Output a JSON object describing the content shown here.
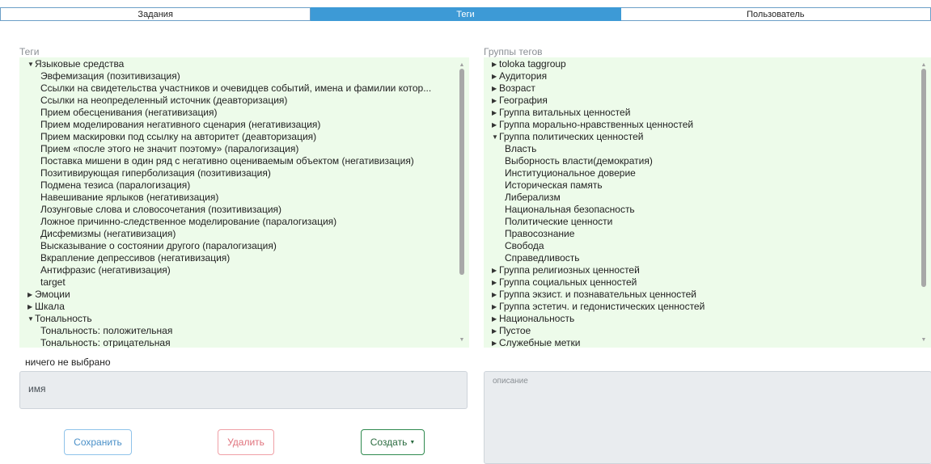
{
  "tabs": [
    {
      "label": "Задания",
      "active": false
    },
    {
      "label": "Теги",
      "active": true
    },
    {
      "label": "Пользователь",
      "active": false
    }
  ],
  "tags_panel": {
    "label": "Теги",
    "items": [
      {
        "text": "Языковые средства",
        "level": 0,
        "state": "expanded"
      },
      {
        "text": "Эвфемизация (позитивизация)",
        "level": 1
      },
      {
        "text": "Ссылки на свидетельства участников и очевидцев событий, имена и фамилии котор...",
        "level": 1
      },
      {
        "text": "Ссылки на неопределенный источник (деавторизация)",
        "level": 1
      },
      {
        "text": "Прием обесценивания (негативизация)",
        "level": 1
      },
      {
        "text": "Прием моделирования негативного сценария (негативизация)",
        "level": 1
      },
      {
        "text": "Прием маскировки под ссылку на авторитет (деавторизация)",
        "level": 1
      },
      {
        "text": "Прием «после этого не значит поэтому» (паралогизация)",
        "level": 1
      },
      {
        "text": "Поставка мишени в один ряд с негативно оцениваемым объектом (негативизация)",
        "level": 1
      },
      {
        "text": "Позитивирующая гиперболизация (позитивизация)",
        "level": 1
      },
      {
        "text": "Подмена тезиса (паралогизация)",
        "level": 1
      },
      {
        "text": "Навешивание ярлыков (негативизация)",
        "level": 1
      },
      {
        "text": "Лозунговые слова и словосочетания (позитивизация)",
        "level": 1
      },
      {
        "text": "Ложное причинно-следственное моделирование (паралогизация)",
        "level": 1
      },
      {
        "text": "Дисфемизмы (негативизация)",
        "level": 1
      },
      {
        "text": "Высказывание о состоянии другого (паралогизация)",
        "level": 1
      },
      {
        "text": "Вкрапление депрессивов (негативизация)",
        "level": 1
      },
      {
        "text": "Антифразис (негативизация)",
        "level": 1
      },
      {
        "text": "target",
        "level": 1
      },
      {
        "text": "Эмоции",
        "level": 0,
        "state": "collapsed"
      },
      {
        "text": "Шкала",
        "level": 0,
        "state": "collapsed"
      },
      {
        "text": "Тональность",
        "level": 0,
        "state": "expanded"
      },
      {
        "text": "Тональность: положительная",
        "level": 1
      },
      {
        "text": "Тональность: отрицательная",
        "level": 1
      }
    ]
  },
  "groups_panel": {
    "label": "Группы тегов",
    "items": [
      {
        "text": "toloka taggroup",
        "level": 0,
        "state": "collapsed"
      },
      {
        "text": "Аудитория",
        "level": 0,
        "state": "collapsed"
      },
      {
        "text": "Возраст",
        "level": 0,
        "state": "collapsed"
      },
      {
        "text": "География",
        "level": 0,
        "state": "collapsed"
      },
      {
        "text": "Группа витальных ценностей",
        "level": 0,
        "state": "collapsed"
      },
      {
        "text": "Группа морально-нравственных ценностей",
        "level": 0,
        "state": "collapsed"
      },
      {
        "text": "Группа политических ценностей",
        "level": 0,
        "state": "expanded"
      },
      {
        "text": "Власть",
        "level": 1
      },
      {
        "text": "Выборность власти(демократия)",
        "level": 1
      },
      {
        "text": "Институциональное доверие",
        "level": 1
      },
      {
        "text": "Историческая память",
        "level": 1
      },
      {
        "text": "Либерализм",
        "level": 1
      },
      {
        "text": "Национальная безопасность",
        "level": 1
      },
      {
        "text": "Политические ценности",
        "level": 1
      },
      {
        "text": "Правосознание",
        "level": 1
      },
      {
        "text": "Свобода",
        "level": 1
      },
      {
        "text": "Справедливость",
        "level": 1
      },
      {
        "text": "Группа религиозных ценностей",
        "level": 0,
        "state": "collapsed"
      },
      {
        "text": "Группа социальных ценностей",
        "level": 0,
        "state": "collapsed"
      },
      {
        "text": "Группа экзист. и познавательных ценностей",
        "level": 0,
        "state": "collapsed"
      },
      {
        "text": "Группа эстетич. и гедонистических ценностей",
        "level": 0,
        "state": "collapsed"
      },
      {
        "text": "Национальность",
        "level": 0,
        "state": "collapsed"
      },
      {
        "text": "Пустое",
        "level": 0,
        "state": "collapsed"
      },
      {
        "text": "Служебные метки",
        "level": 0,
        "state": "collapsed"
      }
    ]
  },
  "form": {
    "status": "ничего не выбрано",
    "name_placeholder": "имя",
    "description_placeholder": "описание",
    "save_label": "Сохранить",
    "delete_label": "Удалить",
    "create_label": "Создать"
  },
  "colors": {
    "active_tab": "#3d9ad6",
    "tree_background": "#edfbea",
    "field_background": "#e9ecef"
  }
}
